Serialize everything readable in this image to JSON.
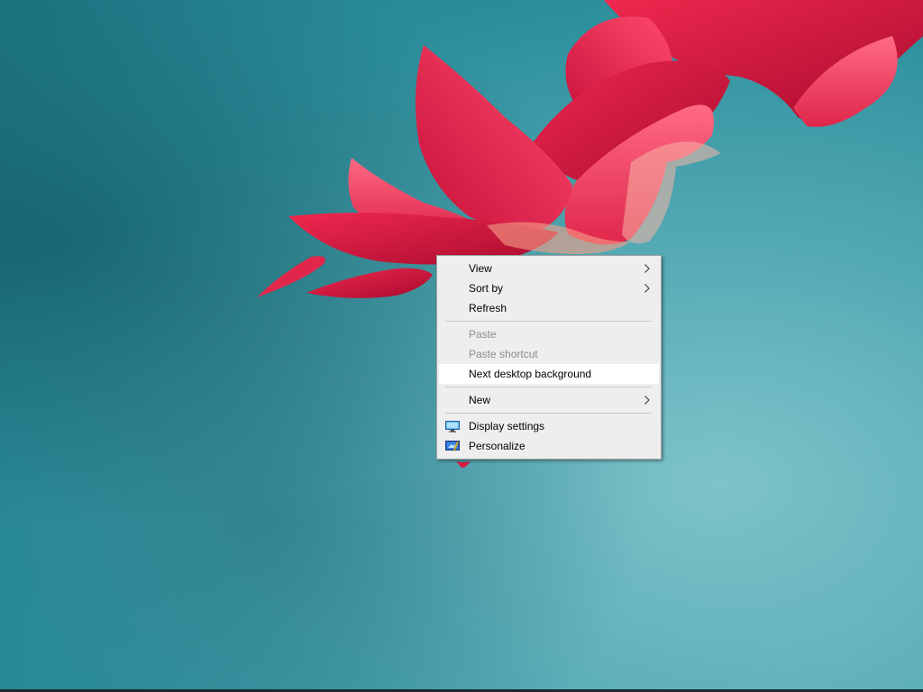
{
  "context_menu": {
    "items": [
      {
        "label": "View",
        "has_submenu": true
      },
      {
        "label": "Sort by",
        "has_submenu": true
      },
      {
        "label": "Refresh"
      },
      {
        "label": "Paste",
        "disabled": true
      },
      {
        "label": "Paste shortcut",
        "disabled": true
      },
      {
        "label": "Next desktop background",
        "highlighted": true
      },
      {
        "label": "New",
        "has_submenu": true
      },
      {
        "label": "Display settings",
        "icon": "display-settings-icon"
      },
      {
        "label": "Personalize",
        "icon": "personalize-icon"
      }
    ]
  },
  "colors": {
    "wallpaper_teal": "#2d8f9c",
    "flower_red": "#d81a43",
    "menu_background": "#eeeeee",
    "menu_hover": "#ffffff",
    "disabled_text": "#8d8d8d"
  }
}
